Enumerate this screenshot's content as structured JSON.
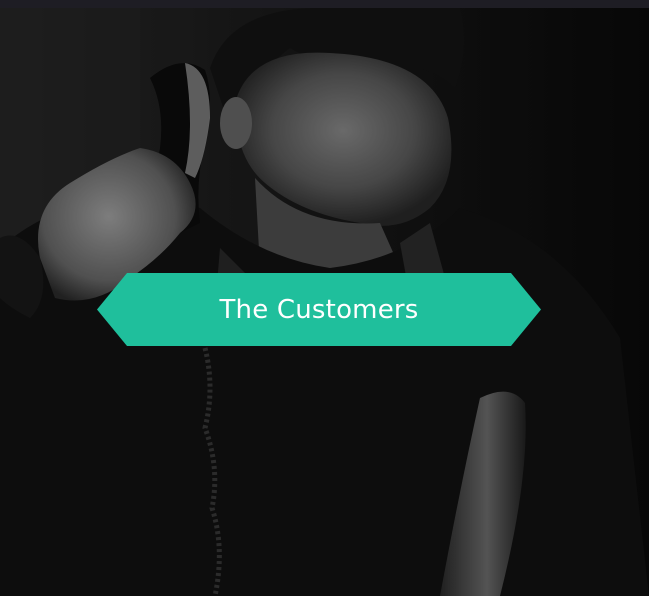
{
  "hero": {
    "image_subject": "man-on-phone-photo",
    "cta_label": "The Customers",
    "accent_color": "#1fbf9c"
  }
}
